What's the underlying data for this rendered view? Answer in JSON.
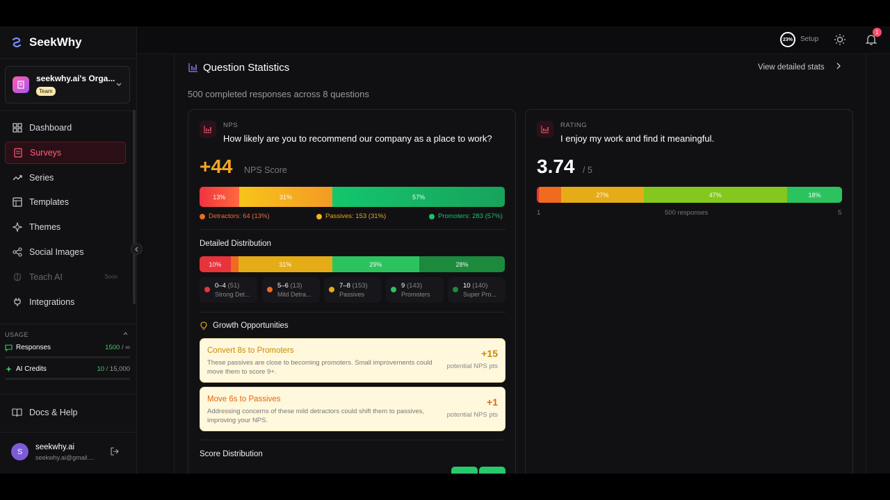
{
  "app": {
    "name": "SeekWhy"
  },
  "org": {
    "name": "seekwhy.ai's Orga...",
    "badge": "Team"
  },
  "nav": [
    {
      "label": "Dashboard",
      "icon": "grid-icon",
      "active": false,
      "muted": false
    },
    {
      "label": "Surveys",
      "icon": "document-icon",
      "active": true,
      "muted": false
    },
    {
      "label": "Series",
      "icon": "trend-icon",
      "active": false,
      "muted": false
    },
    {
      "label": "Templates",
      "icon": "layout-icon",
      "active": false,
      "muted": false
    },
    {
      "label": "Themes",
      "icon": "sparkle-icon",
      "active": false,
      "muted": false
    },
    {
      "label": "Social Images",
      "icon": "share-icon",
      "active": false,
      "muted": false
    },
    {
      "label": "Teach AI",
      "icon": "brain-icon",
      "active": false,
      "muted": true,
      "soon": "Soon"
    },
    {
      "label": "Integrations",
      "icon": "plug-icon",
      "active": false,
      "muted": false
    }
  ],
  "usage": {
    "title": "USAGE",
    "responses": {
      "label": "Responses",
      "value": "1500",
      "limit": " / ∞"
    },
    "credits": {
      "label": "AI Credits",
      "value": "10",
      "limit": " / 15,000"
    }
  },
  "docs": {
    "label": "Docs & Help"
  },
  "user": {
    "initial": "S",
    "name": "seekwhy.ai",
    "email": "seekwhy.ai@gmail...."
  },
  "topbar": {
    "setup_pct": "23%",
    "setup_label": "Setup",
    "notif_count": "1"
  },
  "page": {
    "title": "Question Statistics",
    "view_detailed": "View detailed stats",
    "summary": "500 completed responses across 8 questions"
  },
  "nps": {
    "type": "NPS",
    "question": "How likely are you to recommend our company as a place to work?",
    "score": "+44",
    "score_label": "NPS Score",
    "segments": [
      {
        "label": "13%",
        "pct": 13,
        "color": "#ef3340"
      },
      {
        "label": "31%",
        "pct": 31,
        "color": "#f5a623"
      },
      {
        "label": "57%",
        "pct": 57,
        "color": "#1fbf6a"
      }
    ],
    "legend": {
      "detractors": "Detractors: 64 (13%)",
      "passives": "Passives: 153 (31%)",
      "promoters": "Promoters: 283 (57%)"
    },
    "distribution_title": "Detailed Distribution",
    "distribution": [
      {
        "label": "10%",
        "pct": 10.2,
        "color": "#e8333a"
      },
      {
        "label": "",
        "pct": 2.6,
        "color": "#f06a1f"
      },
      {
        "label": "31%",
        "pct": 30.6,
        "color": "#e5ac17"
      },
      {
        "label": "29%",
        "pct": 28.6,
        "color": "#2cc35f"
      },
      {
        "label": "28%",
        "pct": 28.0,
        "color": "#1b8a3d"
      }
    ],
    "buckets": [
      {
        "range": "0–4",
        "count": "(51)",
        "name": "Strong Det...",
        "color": "#e8333a"
      },
      {
        "range": "5–6",
        "count": "(13)",
        "name": "Mild Detra...",
        "color": "#f06a1f"
      },
      {
        "range": "7–8",
        "count": "(153)",
        "name": "Passives",
        "color": "#e5ac17"
      },
      {
        "range": "9",
        "count": "(143)",
        "name": "Promoters",
        "color": "#2cc35f"
      },
      {
        "range": "10",
        "count": "(140)",
        "name": "Super Pro...",
        "color": "#1b8a3d"
      }
    ],
    "growth_title": "Growth Opportunities",
    "opportunities": [
      {
        "title": "Convert 8s to Promoters",
        "desc": "These passives are close to becoming promoters. Small improvements could move them to score 9+.",
        "value": "+15",
        "sub": "potential NPS pts",
        "color": "#c98a00"
      },
      {
        "title": "Move 6s to Passives",
        "desc": "Addressing concerns of these mild detractors could shift them to passives, improving your NPS.",
        "value": "+1",
        "sub": "potential NPS pts",
        "color": "#e0660f"
      }
    ],
    "score_dist_title": "Score Distribution"
  },
  "rating": {
    "type": "RATING",
    "question": "I enjoy my work and find it meaningful.",
    "score": "3.74",
    "scale": "/ 5",
    "segments": [
      {
        "label": "",
        "pct": 0.6,
        "color": "#e8333a"
      },
      {
        "label": "",
        "pct": 7.4,
        "color": "#f06a1f"
      },
      {
        "label": "27%",
        "pct": 27,
        "color": "#e5ac17"
      },
      {
        "label": "47%",
        "pct": 47,
        "color": "#84c81d"
      },
      {
        "label": "18%",
        "pct": 18,
        "color": "#2cc35f"
      }
    ],
    "min": "1",
    "max": "5",
    "responses": "500 responses"
  },
  "colors": {
    "accent": "#ff4d6d",
    "score": "#f5a623"
  }
}
